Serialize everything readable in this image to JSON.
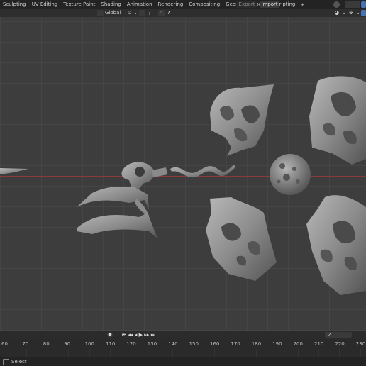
{
  "workspace_tabs": [
    "Sculpting",
    "UV Editing",
    "Texture Paint",
    "Shading",
    "Animation",
    "Rendering",
    "Compositing",
    "Geometry Nodes",
    "Scripting"
  ],
  "add_workspace": "+",
  "buttons": {
    "export": "Export",
    "import": "Import"
  },
  "header": {
    "orientation": "Global"
  },
  "timeline": {
    "current_frame": "2"
  },
  "ruler_ticks": [
    "60",
    "70",
    "80",
    "90",
    "100",
    "110",
    "120",
    "130",
    "140",
    "150",
    "160",
    "170",
    "180",
    "190",
    "200",
    "210",
    "220",
    "230"
  ],
  "status": {
    "left_label": "Select"
  },
  "colors": {
    "x_axis": "#8a3a3a",
    "background": "#3d3d3d",
    "accent": "#4772b3"
  }
}
